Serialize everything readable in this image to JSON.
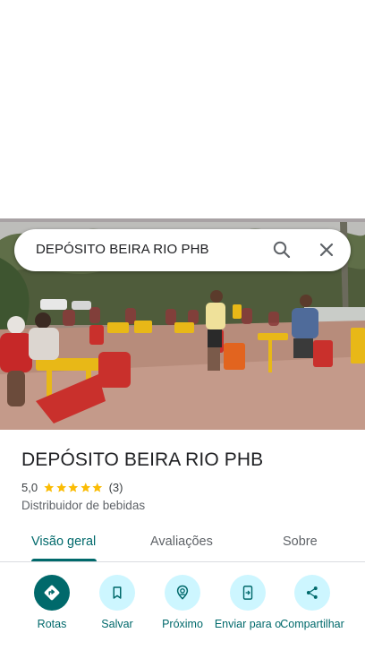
{
  "search": {
    "query": "DEPÓSITO BEIRA RIO PHB",
    "search_icon": "search-icon",
    "close_icon": "close-icon"
  },
  "place": {
    "name": "DEPÓSITO BEIRA RIO PHB",
    "rating": "5,0",
    "stars": 5,
    "review_count": "(3)",
    "category": "Distribuidor de bebidas"
  },
  "tabs": [
    {
      "label": "Visão geral",
      "active": true
    },
    {
      "label": "Avaliações",
      "active": false
    },
    {
      "label": "Sobre",
      "active": false
    }
  ],
  "actions": [
    {
      "label": "Rotas",
      "icon": "directions-icon"
    },
    {
      "label": "Salvar",
      "icon": "bookmark-icon"
    },
    {
      "label": "Próximo",
      "icon": "nearby-icon"
    },
    {
      "label": "Enviar para o",
      "icon": "send-to-phone-icon"
    },
    {
      "label": "Compartilhar",
      "icon": "share-icon"
    }
  ],
  "colors": {
    "accent": "#00696b",
    "action_bg": "#cdf6ff",
    "star": "#fbbc04"
  }
}
